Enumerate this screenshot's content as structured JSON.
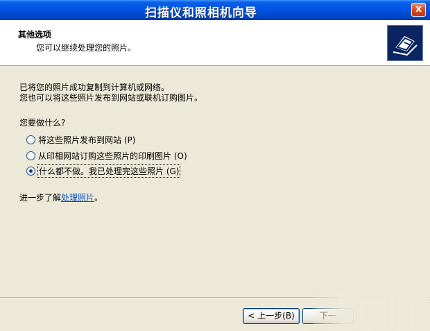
{
  "window": {
    "title": "扫描仪和照相机向导",
    "close_label": "x"
  },
  "header": {
    "title": "其他选项",
    "subtitle": "您可以继续处理您的照片。"
  },
  "body": {
    "line1": "已将您的照片成功复制到计算机或网络。",
    "line2": "您也可以将这些照片发布到网站或联机订购图片。",
    "question": "您要做什么?",
    "options": [
      {
        "label": "将这些照片发布到网站 (P)",
        "checked": false
      },
      {
        "label": "从印相网站订购这些照片的印刷图片 (O)",
        "checked": false
      },
      {
        "label": "什么都不做。我已处理完这些照片 (G)",
        "checked": true
      }
    ],
    "more_prefix": "进一步了解",
    "more_link": "处理照片",
    "more_suffix": "。"
  },
  "buttons": {
    "back": "< 上一步(B)",
    "next": "下一"
  },
  "colors": {
    "titlebar": "#0054e3",
    "dialog_bg": "#ece9d8",
    "link": "#0b4dc1"
  },
  "icons": {
    "header_icon": "camera-scanner-icon"
  }
}
